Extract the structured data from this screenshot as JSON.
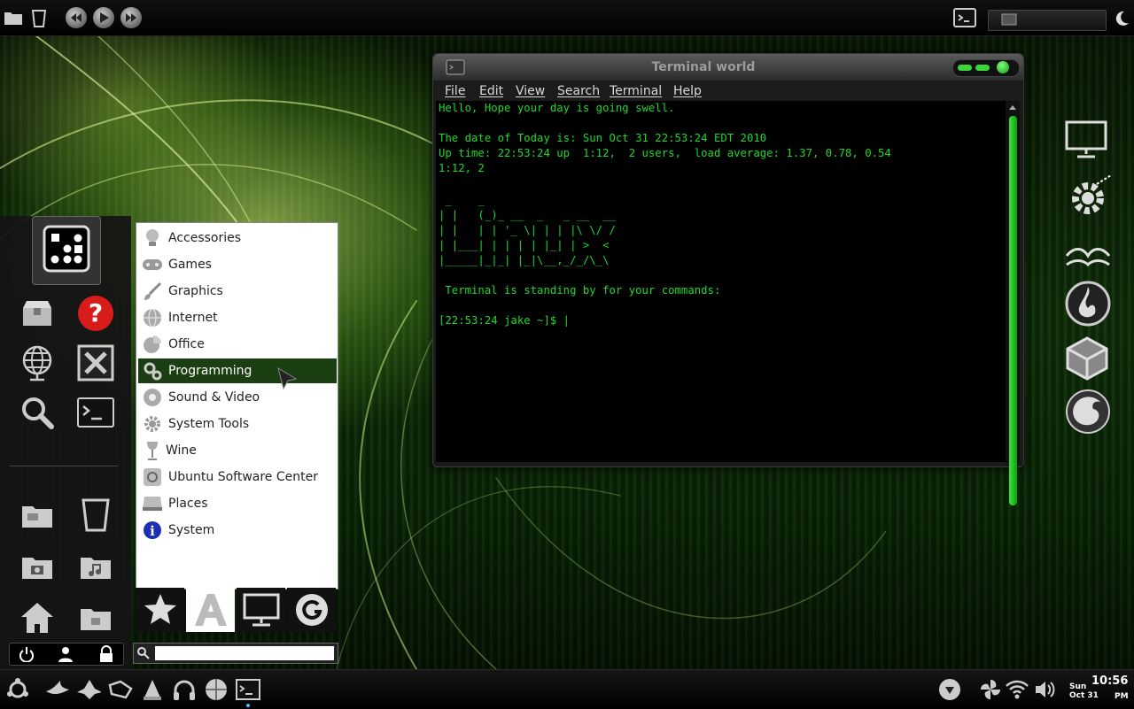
{
  "terminal": {
    "title": "Terminal world",
    "menu": [
      "File",
      "Edit",
      "View",
      "Search",
      "Terminal",
      "Help"
    ],
    "lines": [
      "Hello, Hope your day is going swell.",
      "",
      "The date of Today is: Sun Oct 31 22:53:24 EDT 2010",
      "Up time: 22:53:24 up  1:12,  2 users,  load average: 1.37, 0.78, 0.54",
      "1:12, 2",
      "",
      "",
      " _    _",
      "| |   (_)_ __  _   _ __  __",
      "| |   | | '_ \\| | | |\\ \\/ /",
      "| |___| | | | | |_| | >  <",
      "|_____|_|_| |_|\\__,_/_/\\_\\",
      "",
      " Terminal is standing by for your commands:",
      "",
      "[22:53:24 jake ~]$ |"
    ]
  },
  "menu": {
    "items": [
      "Accessories",
      "Games",
      "Graphics",
      "Internet",
      "Office",
      "Programming",
      "Sound & Video",
      "System Tools",
      "Wine",
      "Ubuntu Software Center",
      "Places",
      "System"
    ],
    "selected": "Programming",
    "tabs": [
      "favorites-icon",
      "applications-icon",
      "computer-icon",
      "recent-icon"
    ]
  },
  "search": {
    "placeholder": ""
  },
  "clock": {
    "day": "Sun",
    "date": "Oct 31",
    "time": "10:56",
    "ampm": "PM"
  },
  "colors": {
    "terminal_text": "#1fd82a",
    "selected_row": "#1b3e12",
    "accent": "#2fd62f"
  }
}
